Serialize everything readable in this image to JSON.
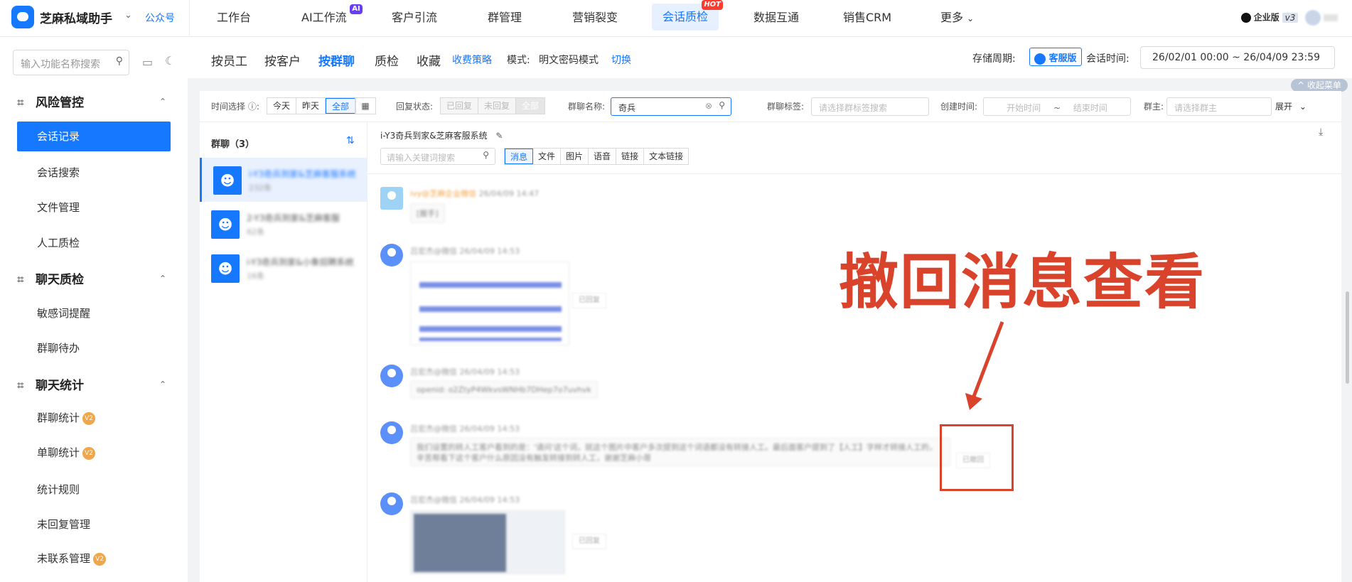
{
  "app": {
    "brand": "芝麻私域助手",
    "public_account": "公众号"
  },
  "nav": [
    "工作台",
    "AI工作流",
    "客户引流",
    "群管理",
    "营销裂变",
    "会话质检",
    "数据互通",
    "销售CRM",
    "更多"
  ],
  "nav_badges": {
    "ai": "AI",
    "hot": "HOT"
  },
  "topright": {
    "edition": "企业版",
    "version": "v3"
  },
  "sidebar": {
    "search_placeholder": "输入功能名称搜索",
    "groups": [
      {
        "title": "风险管控",
        "items": [
          "会话记录",
          "会话搜索",
          "文件管理",
          "人工质检"
        ]
      },
      {
        "title": "聊天质检",
        "items": [
          "敏感词提醒",
          "群聊待办"
        ]
      },
      {
        "title": "聊天统计",
        "items": [
          "群聊统计",
          "单聊统计",
          "统计规则",
          "未回复管理",
          "未联系管理"
        ]
      }
    ],
    "v2_badge": "V2"
  },
  "tabs": {
    "items": [
      "按员工",
      "按客户",
      "按群聊",
      "质检",
      "收藏"
    ],
    "active": "按群聊",
    "fee_link": "收费策略",
    "mode_label": "模式:",
    "mode_value": "明文密码模式",
    "switch_link": "切换",
    "storage_label": "存储周期:",
    "storage_value": "客服版",
    "session_time_label": "会话时间:",
    "session_time_value": "26/02/01 00:00 ~ 26/04/09 23:59",
    "collapse_menu": "^ 收起菜单"
  },
  "filters": {
    "time_label": "时间选择",
    "time_options": [
      "今天",
      "昨天",
      "全部"
    ],
    "time_active": "全部",
    "reply_label": "回复状态:",
    "reply_options": [
      "已回复",
      "未回复",
      "全部"
    ],
    "group_name_label": "群聊名称:",
    "group_name_value": "奇兵",
    "group_tag_label": "群聊标签:",
    "group_tag_placeholder": "请选择群标签搜索",
    "create_time_label": "创建时间:",
    "create_start": "开始时间",
    "create_tilde": "~",
    "create_end": "结束时间",
    "owner_label": "群主:",
    "owner_placeholder": "请选择群主",
    "expand": "展开"
  },
  "group_list": {
    "header": "群聊（3）",
    "items": [
      {
        "name": "i-Y3奇兵到家&芝麻客服系统",
        "sub": "232条"
      },
      {
        "name": "2-Y3奇兵到家&芝麻客服",
        "sub": "62条"
      },
      {
        "name": "i-Y3奇兵到家&小象招聘系统",
        "sub": "16条"
      }
    ]
  },
  "chat": {
    "title": "i-Y3奇兵到家&芝麻客服系统",
    "keyword_placeholder": "请输入关键词搜索",
    "msg_types": [
      "消息",
      "文件",
      "图片",
      "语音",
      "链接",
      "文本链接"
    ],
    "msg_type_active": "消息",
    "messages": [
      {
        "sender": "ivy@芝麻企业微信",
        "time": "26/04/09 14:47",
        "text": "[握手]"
      },
      {
        "sender": "吕宏杰@微信",
        "time": "26/04/09 14:53",
        "text": "",
        "status": "已回复"
      },
      {
        "sender": "吕宏杰@微信",
        "time": "26/04/09 14:53",
        "text": "openid: o2ZtyP4WkvsWNHb7DHep7o7uvhvk"
      },
      {
        "sender": "吕宏杰@微信",
        "time": "26/04/09 14:53",
        "text": "我们设置的转人工客户看到的是：'请问'这个词，就这个图片中客户多次提到这个词语都没有转接人工。最后面客户提到了【人工】字样才转接人工的，辛苦帮看下这个客户什么原因没有触发转接到转人工，谢谢芝麻小哥",
        "status": "已撤回"
      },
      {
        "sender": "吕宏杰@微信",
        "time": "26/04/09 14:53",
        "text": "",
        "status": "已回复"
      }
    ]
  },
  "annotation": "撤回消息查看"
}
